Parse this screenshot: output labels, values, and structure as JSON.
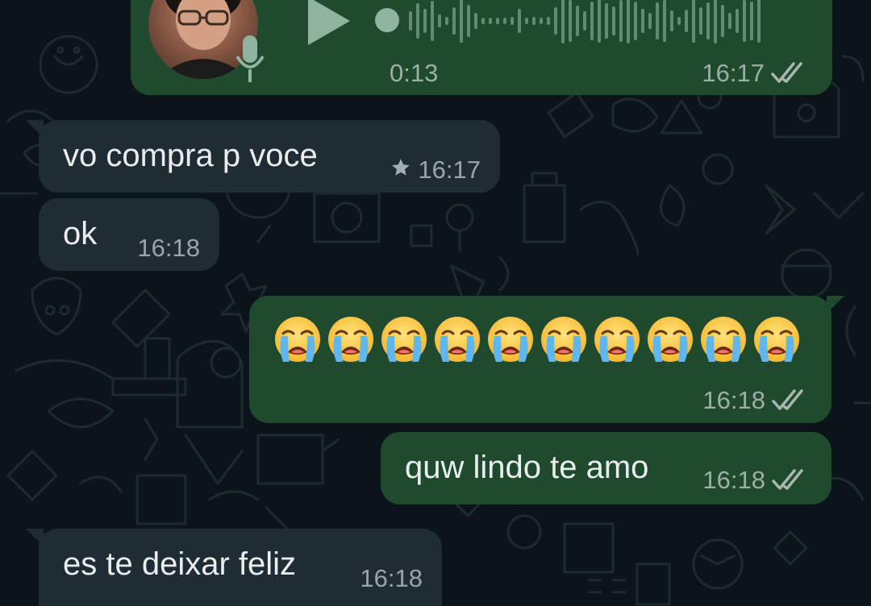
{
  "theme": {
    "background": "#0b141a",
    "incoming_bubble": "#202c33",
    "outgoing_bubble": "#1f4a2e",
    "text": "#e9edef",
    "meta_text": "#8696a0",
    "tick_color": "#8696a0"
  },
  "messages": [
    {
      "kind": "voice",
      "direction": "outgoing",
      "duration": "0:13",
      "time": "16:17",
      "status": "sent"
    },
    {
      "kind": "text",
      "direction": "incoming",
      "text": "vo compra p voce",
      "time": "16:17",
      "starred": true
    },
    {
      "kind": "text",
      "direction": "incoming",
      "text": "ok",
      "time": "16:18"
    },
    {
      "kind": "emoji",
      "direction": "outgoing",
      "emoji": "loudly-crying-face",
      "count": 10,
      "time": "16:18",
      "status": "sent"
    },
    {
      "kind": "text",
      "direction": "outgoing",
      "text": "quw lindo te amo",
      "time": "16:18",
      "status": "sent"
    },
    {
      "kind": "text",
      "direction": "incoming",
      "text": "es te deixar feliz",
      "time": "16:18"
    }
  ],
  "icons": {
    "play": "play-icon",
    "mic": "mic-icon",
    "star": "star-icon",
    "ticks": "double-check-icon"
  }
}
